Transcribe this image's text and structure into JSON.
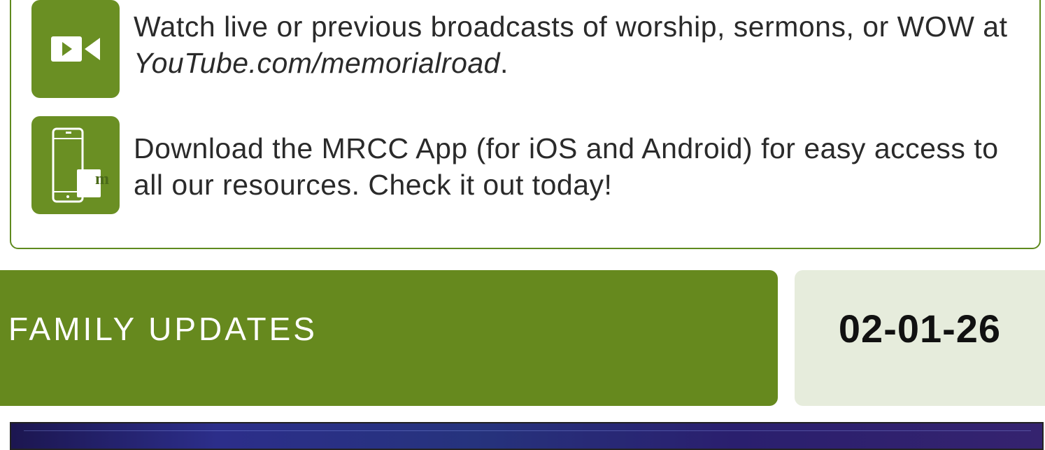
{
  "resources": {
    "items": [
      {
        "icon": "video-camera-icon",
        "text_before": "Watch live or previous broadcasts of worship, sermons, or WOW at ",
        "link": "YouTube.com/memorialroad",
        "text_after": "."
      },
      {
        "icon": "mobile-app-icon",
        "icon_letter": "m",
        "text": "Download the MRCC App (for iOS and Android) for easy access to all our resources. Check it out today!"
      }
    ]
  },
  "updates": {
    "title": "FAMILY UPDATES",
    "date": "02-01-26"
  },
  "colors": {
    "accent_green": "#66891e",
    "date_background": "#e6ecdc",
    "image_strip": "#2c2e8a"
  }
}
